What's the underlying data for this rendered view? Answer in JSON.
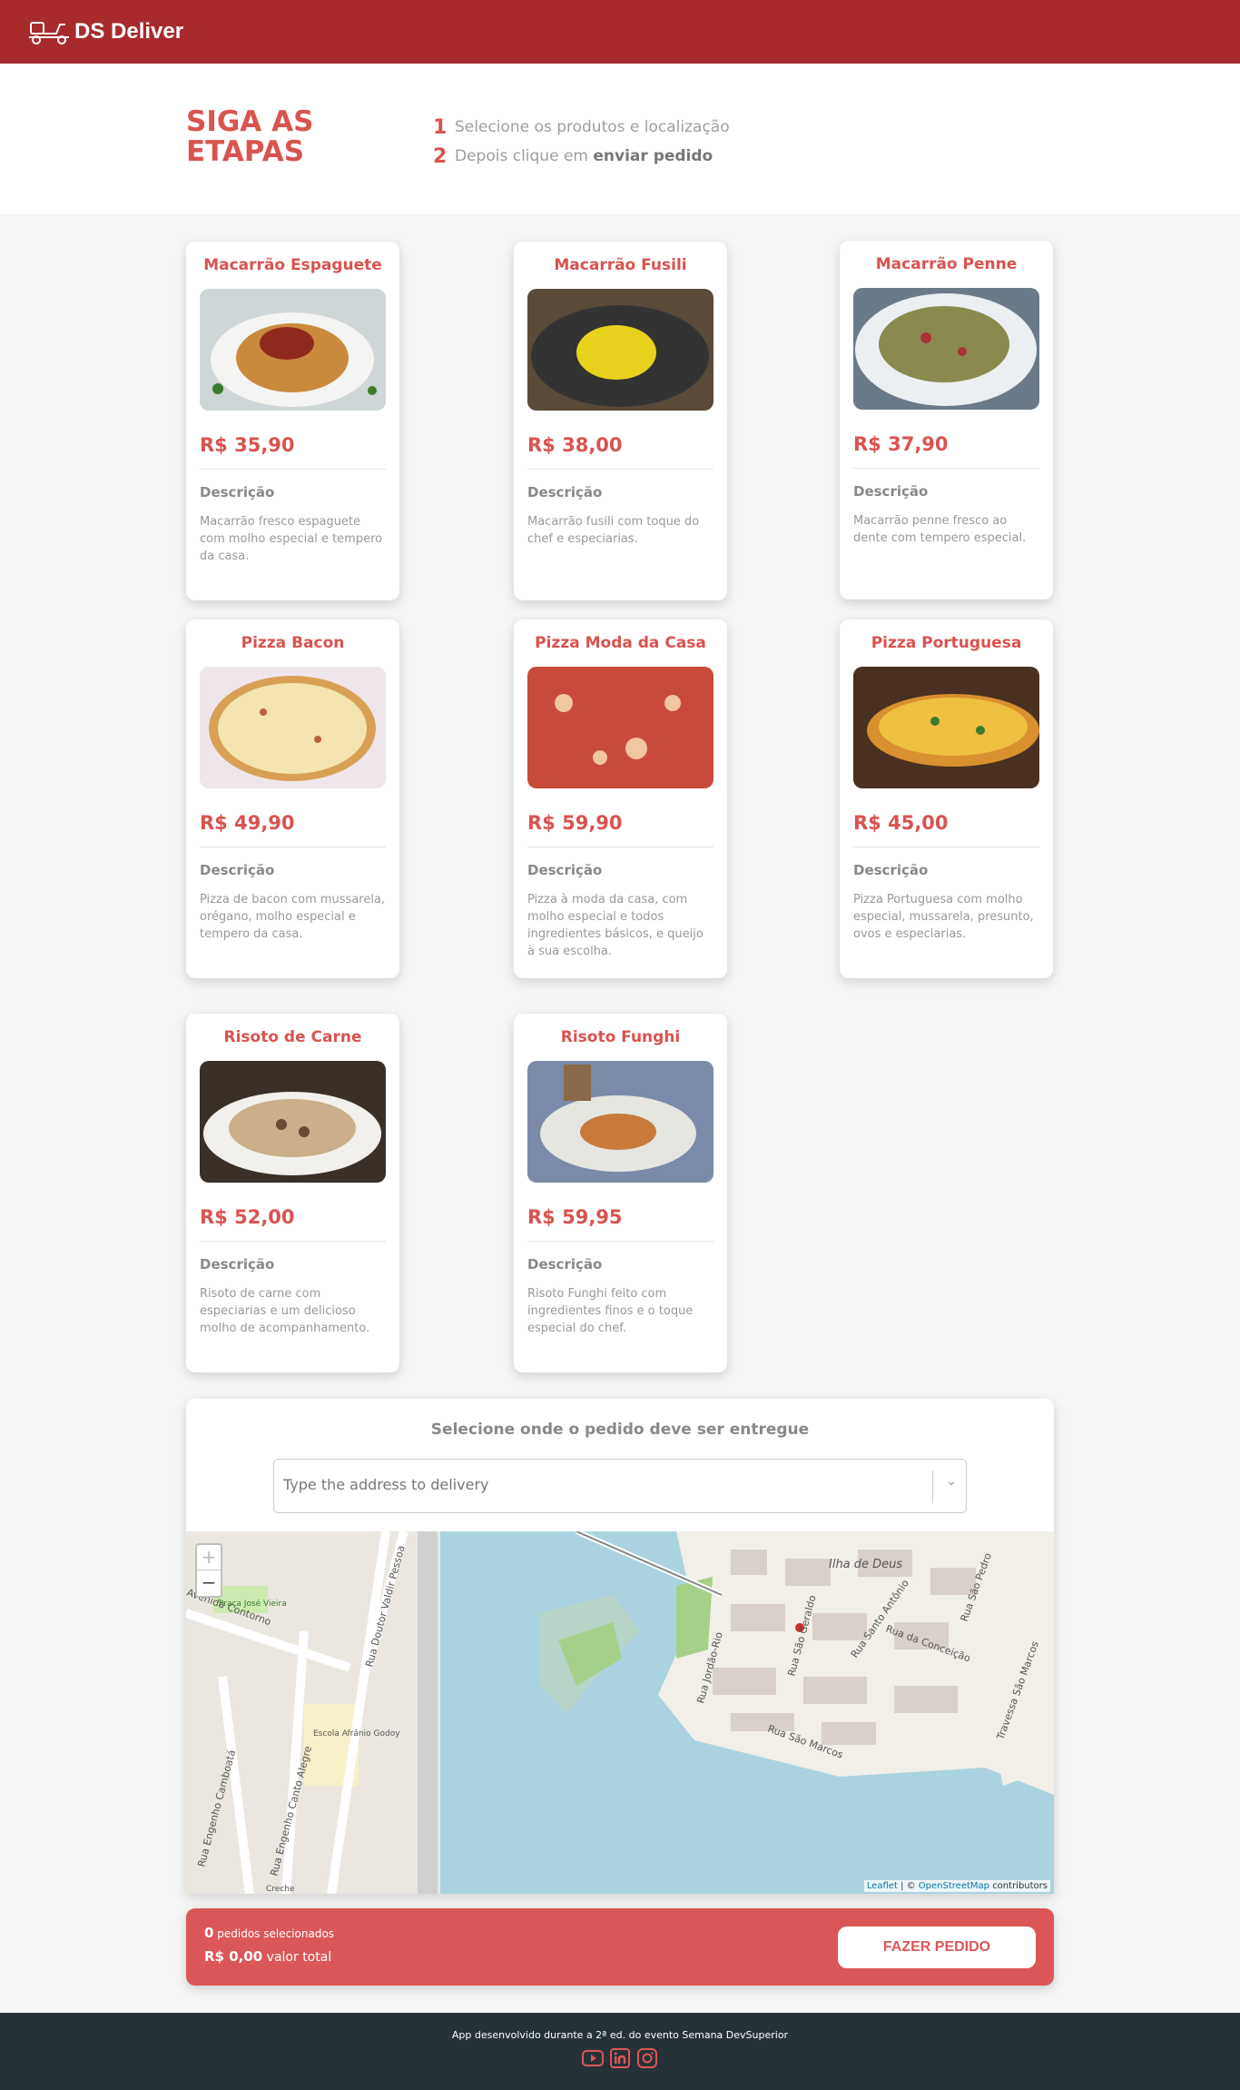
{
  "header": {
    "brand": "DS Deliver"
  },
  "steps": {
    "title_line1": "SIGA AS",
    "title_line2": "ETAPAS",
    "items": [
      {
        "num": "1",
        "text": "Selecione os produtos e localização"
      },
      {
        "num": "2",
        "text": "Depois clique em",
        "bold": "enviar pedido"
      }
    ]
  },
  "products": [
    {
      "name": "Macarrão Espaguete",
      "price": "R$ 35,90",
      "desc_title": "Descrição",
      "desc": "Macarrão fresco espaguete com molho especial e tempero da casa."
    },
    {
      "name": "Macarrão Fusili",
      "price": "R$ 38,00",
      "desc_title": "Descrição",
      "desc": "Macarrão fusili com toque do chef e especiarias."
    },
    {
      "name": "Macarrão Penne",
      "price": "R$ 37,90",
      "desc_title": "Descrição",
      "desc": "Macarrão penne fresco ao dente com tempero especial."
    },
    {
      "name": "Pizza Bacon",
      "price": "R$ 49,90",
      "desc_title": "Descrição",
      "desc": "Pizza de bacon com mussarela, orégano, molho especial e tempero da casa."
    },
    {
      "name": "Pizza Moda da Casa",
      "price": "R$ 59,90",
      "desc_title": "Descrição",
      "desc": "Pizza à moda da casa, com molho especial e todos ingredientes básicos, e queijo à sua escolha."
    },
    {
      "name": "Pizza Portuguesa",
      "price": "R$ 45,00",
      "desc_title": "Descrição",
      "desc": "Pizza Portuguesa com molho especial, mussarela, presunto, ovos e especiarias."
    },
    {
      "name": "Risoto de Carne",
      "price": "R$ 52,00",
      "desc_title": "Descrição",
      "desc": "Risoto de carne com especiarias e um delicioso molho de acompanhamento."
    },
    {
      "name": "Risoto Funghi",
      "price": "R$ 59,95",
      "desc_title": "Descrição",
      "desc": "Risoto Funghi feito com ingredientes finos e o toque especial do chef."
    }
  ],
  "delivery": {
    "title": "Selecione onde o pedido deve ser entregue",
    "placeholder": "Type the address to delivery",
    "zoom_in": "+",
    "zoom_out": "−",
    "map_labels": {
      "ilha": "Ilha de Deus",
      "r1": "Rua São Marcos",
      "r2": "Rua Jordão-Rio",
      "r3": "Rua Santo Antônio",
      "r4": "Rua da Conceição",
      "r5": "Rua São Pedro",
      "r6": "Travessa São Marcos",
      "r7": "Rua Engenho Camboatá",
      "r8": "Rua Engenho Canto Alegre",
      "r9": "Rua Doutor Valdir Pessoa",
      "r10": "Praça José Vieira",
      "r11": "Escola Afrânio Godoy",
      "r12": "Creche",
      "r13": "Avenida Contorno",
      "r14": "Rua São Geraldo"
    },
    "attribution_leaflet": "Leaflet",
    "attribution_osm": "OpenStreetMap",
    "attribution_rest": "contributors"
  },
  "summary": {
    "count": "0",
    "count_label": "pedidos selecionados",
    "total": "R$ 0,00",
    "total_label": "valor total",
    "button": "FAZER PEDIDO"
  },
  "footer": {
    "text": "App desenvolvido durante a 2ª ed. do evento Semana DevSuperior"
  },
  "colors": {
    "primary": "#a82a2a",
    "accent": "#db5757",
    "footer": "#263238"
  }
}
